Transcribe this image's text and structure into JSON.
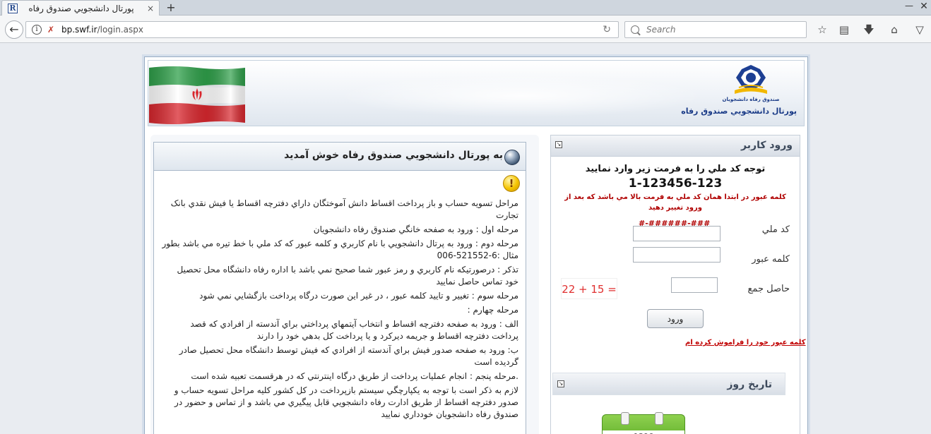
{
  "browser": {
    "tab_title": "پورتال دانشجويي صندوق رفاه",
    "tab_favicon": "R",
    "tab_close": "×",
    "new_tab": "+",
    "window_minimize": "—",
    "window_close": "✕",
    "url_domain": "bp.swf.ir",
    "url_path": "/login.aspx",
    "search_placeholder": "Search",
    "toolbar_icons": [
      "bookmark-star-icon",
      "reading-list-icon",
      "download-icon",
      "home-icon",
      "pocket-icon"
    ]
  },
  "header": {
    "logo_small_text": "صندوق رفاه دانشجويان",
    "logo_title": "پورتال دانشجويي صندوق رفاه",
    "flag": "iran-flag"
  },
  "login": {
    "title": "ورود کاربر",
    "hint_title": "توجه کد ملي را به فرمت زير وارد نماييد",
    "hint_example": "1-123456-123",
    "hint_note": "کلمه عبور در ابتدا همان کد ملي به فرمت بالا مي باشد که بعد از ورود تغيير دهيد",
    "national_id_mask": "#-######-###",
    "national_id_label": "کد ملي",
    "national_id_value": "",
    "password_label": "کلمه عبور",
    "password_value": "",
    "sum_label": "حاصل جمع",
    "sum_value": "",
    "captcha": "22 + 15 =",
    "submit_label": "ورود",
    "forgot_link": "کلمه عبور خود را فراموش کرده ام"
  },
  "date_panel": {
    "title": "تاريخ روز",
    "year": "1396"
  },
  "welcome": {
    "title": "به پورتال دانشجويي صندوق رفاه خوش آمديد",
    "steps": [
      "مراحل تسويه حساب و باز پرداخت اقساط دانش آموختگان داراي دفترچه اقساط يا فيش نقدي بانک تجارت",
      "مرحله اول : ورود به صفحه خانگي صندوق رفاه دانشجويان",
      "مرحله دوم : ورود به پرتال دانشجويي با نام کاربري و کلمه عبور که کد ملي با خط تيره مي باشد بطور مثال :6-521552-006",
      "تذکر : درصورتيکه نام کاربري و رمز عبور شما صحيح نمي باشد با اداره رفاه دانشگاه محل تحصيل خود تماس حاصل نماييد",
      "مرحله سوم : تغيير و تاييد کلمه عبور ، در غير اين صورت درگاه پرداخت بازگشايي نمي شود",
      "مرحله چهارم :",
      "الف : ورود به صفحه دفترچه اقساط و انتخاب آيتمهاي پرداختي براي آندسته از افرادي که قصد پرداخت دفترچه اقساط و جريمه ديرکرد و يا پرداخت کل بدهي خود را دارند",
      "ب: ورود به صفحه صدور فيش براي آندسته از افرادي که فيش توسط دانشگاه محل تحصيل صادر گرديده است",
      ".مرحله پنجم : انجام عمليات پرداخت از طريق درگاه اينترنتي که در هرقسمت تعبيه شده است",
      "لازم به ذکر است با توجه به يکپارچگي سيستم بازپرداخت در کل کشور کليه مراحل تسويه حساب و صدور دفترچه اقساط از طريق ادارت رفاه دانشجويي قابل پيگيري مي باشد و از تماس و حضور در صندوق رفاه دانشجويان خودداري نماييد"
    ]
  }
}
